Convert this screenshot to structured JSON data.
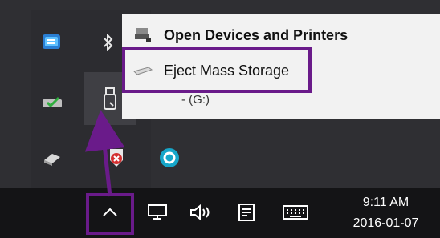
{
  "menu": {
    "items": [
      {
        "label": "Open Devices and Printers",
        "icon": "devices-printers-icon"
      },
      {
        "label": "Eject Mass Storage",
        "icon": "usb-drive-icon"
      }
    ],
    "drive_letter": "-    (G:)"
  },
  "tray": {
    "icons": [
      "network-adapter-icon",
      "bluetooth-icon",
      "usb-drive-icon",
      "scanner-icon",
      "antivirus-icon",
      "aria-app-icon"
    ]
  },
  "taskbar": {
    "icons": [
      "show-hidden-icons-chevron",
      "network-icon",
      "volume-icon",
      "action-center-icon",
      "keyboard-icon"
    ],
    "time": "9:11 AM",
    "date": "2016-01-07"
  },
  "colors": {
    "highlight": "#6a1b8a",
    "menu_bg": "#f2f2f2",
    "tray_bg": "#2c2c30",
    "taskbar_bg": "#141416"
  }
}
